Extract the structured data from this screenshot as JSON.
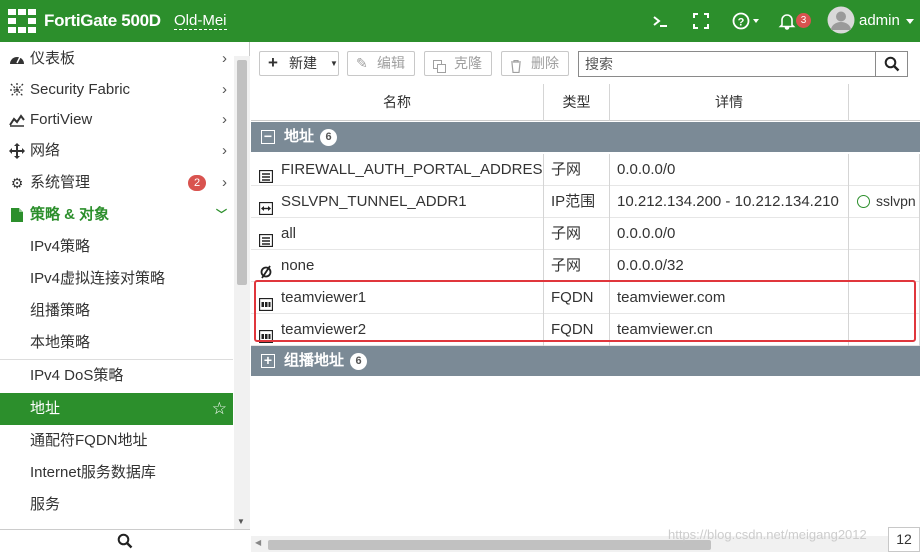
{
  "topbar": {
    "brand": "FortiGate 500D",
    "hostname": "Old-Mei",
    "notification_count": "3",
    "user": "admin"
  },
  "sidebar": {
    "items": [
      {
        "label": "仪表板",
        "icon": "dashboard-icon"
      },
      {
        "label": "Security Fabric",
        "icon": "security-fabric-icon"
      },
      {
        "label": "FortiView",
        "icon": "fortiview-chart-icon"
      },
      {
        "label": "网络",
        "icon": "network-icon"
      },
      {
        "label": "系统管理",
        "icon": "gear-icon",
        "badge": "2"
      },
      {
        "label": "策略 & 对象",
        "icon": "policy-icon"
      }
    ],
    "sub_items": [
      {
        "label": "IPv4策略"
      },
      {
        "label": "IPv4虚拟连接对策略"
      },
      {
        "label": "组播策略"
      },
      {
        "label": "本地策略"
      },
      {
        "label": "IPv4 DoS策略"
      },
      {
        "label": "地址"
      },
      {
        "label": "通配符FQDN地址"
      },
      {
        "label": "Internet服务数据库"
      },
      {
        "label": "服务"
      }
    ]
  },
  "toolbar": {
    "new_label": "新建",
    "edit_label": "编辑",
    "clone_label": "克隆",
    "delete_label": "删除",
    "search_placeholder": "搜索"
  },
  "table": {
    "columns": [
      "名称",
      "类型",
      "详情"
    ],
    "group1": {
      "label": "地址",
      "count": "6"
    },
    "rows": [
      {
        "name": "FIREWALL_AUTH_PORTAL_ADDRESS",
        "type": "子网",
        "details": "0.0.0.0/0",
        "extra": "",
        "icon": "subnet-address-icon"
      },
      {
        "name": "SSLVPN_TUNNEL_ADDR1",
        "type": "IP范围",
        "details": "10.212.134.200 - 10.212.134.210",
        "extra": "sslvpn",
        "icon": "ip-range-icon"
      },
      {
        "name": "all",
        "type": "子网",
        "details": "0.0.0.0/0",
        "extra": "",
        "icon": "subnet-address-icon"
      },
      {
        "name": "none",
        "type": "子网",
        "details": "0.0.0.0/32",
        "extra": "",
        "icon": "none-address-icon"
      },
      {
        "name": "teamviewer1",
        "type": "FQDN",
        "details": "teamviewer.com",
        "extra": "",
        "icon": "fqdn-address-icon"
      },
      {
        "name": "teamviewer2",
        "type": "FQDN",
        "details": "teamviewer.cn",
        "extra": "",
        "icon": "fqdn-address-icon"
      }
    ],
    "group2": {
      "label": "组播地址",
      "count": "6"
    }
  },
  "footer": {
    "page_count": "12",
    "watermark": "https://blog.csdn.net/meigang2012"
  },
  "colors": {
    "brand_green": "#2c8f2c",
    "group_header": "#7b8a96",
    "highlight": "#e0363c"
  }
}
